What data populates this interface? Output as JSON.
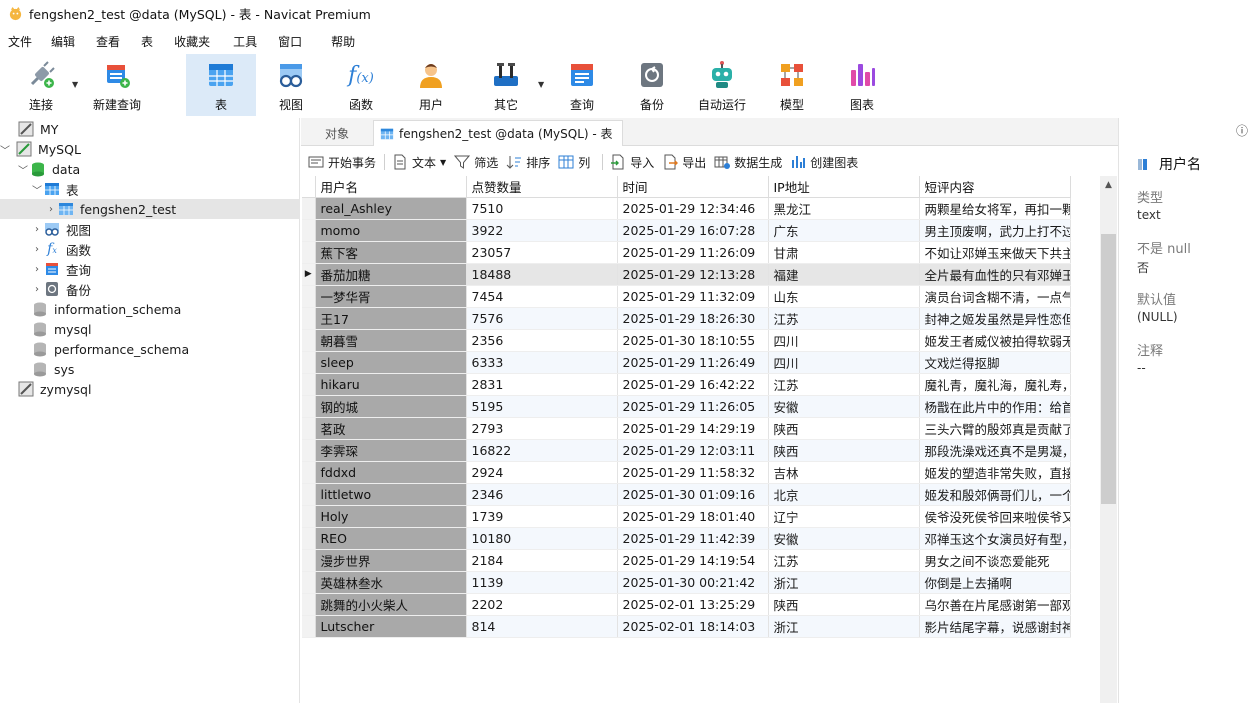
{
  "window": {
    "title": "fengshen2_test @data (MySQL) - 表 - Navicat Premium"
  },
  "menu": [
    "文件",
    "编辑",
    "查看",
    "表",
    "收藏夹",
    "工具",
    "窗口",
    "帮助"
  ],
  "toolbar": {
    "connect": "连接",
    "new_query": "新建查询",
    "table": "表",
    "view": "视图",
    "function": "函数",
    "user": "用户",
    "other": "其它",
    "query": "查询",
    "backup": "备份",
    "autorun": "自动运行",
    "model": "模型",
    "chart": "图表"
  },
  "tree": {
    "my": "MY",
    "mysql": "MySQL",
    "data": "data",
    "tables": "表",
    "fengshen": "fengshen2_test",
    "views": "视图",
    "functions": "函数",
    "queries": "查询",
    "backups": "备份",
    "info_schema": "information_schema",
    "mysql_db": "mysql",
    "perf_schema": "performance_schema",
    "sys": "sys",
    "zymysql": "zymysql"
  },
  "tabs": {
    "objects": "对象",
    "current": "fengshen2_test @data (MySQL) - 表"
  },
  "subtoolbar": {
    "begin_tx": "开始事务",
    "text": "文本",
    "filter": "筛选",
    "sort": "排序",
    "columns": "列",
    "import": "导入",
    "export": "导出",
    "datagen": "数据生成",
    "create_chart": "创建图表"
  },
  "grid": {
    "headers": [
      "用户名",
      "点赞数量",
      "时间",
      "IP地址",
      "短评内容"
    ],
    "rows": [
      [
        "real_Ashley",
        "7510",
        "2025-01-29 12:34:46",
        "黑龙江",
        "两颗星给女将军，再扣一颗"
      ],
      [
        "momo",
        "3922",
        "2025-01-29 16:07:28",
        "广东",
        "男主顶废啊，武力上打不过"
      ],
      [
        "蕉下客",
        "23057",
        "2025-01-29 11:26:09",
        "甘肃",
        "不如让邓婵玉来做天下共主"
      ],
      [
        "番茄加糖",
        "18488",
        "2025-01-29 12:13:28",
        "福建",
        "全片最有血性的只有邓婵玉"
      ],
      [
        "一梦华胥",
        "7454",
        "2025-01-29 11:32:09",
        "山东",
        "演员台词含糊不清，一点气"
      ],
      [
        "王17",
        "7576",
        "2025-01-29 18:26:30",
        "江苏",
        "封神之姬发虽然是异性恋但"
      ],
      [
        "朝暮雪",
        "2356",
        "2025-01-30 18:10:55",
        "四川",
        "姬发王者威仪被拍得软弱无"
      ],
      [
        "sleep",
        "6333",
        "2025-01-29 11:26:49",
        "四川",
        "文戏烂得抠脚"
      ],
      [
        "hikaru",
        "2831",
        "2025-01-29 16:42:22",
        "江苏",
        "魔礼青，魔礼海，魔礼寿，"
      ],
      [
        "钢的城",
        "5195",
        "2025-01-29 11:26:05",
        "安徽",
        "杨戬在此片中的作用：给首"
      ],
      [
        "茗政",
        "2793",
        "2025-01-29 14:29:19",
        "陕西",
        "三头六臂的殷郊真是贡献了"
      ],
      [
        "李霁琛",
        "16822",
        "2025-01-29 12:03:11",
        "陕西",
        "那段洗澡戏还真不是男凝，"
      ],
      [
        "fddxd",
        "2924",
        "2025-01-29 11:58:32",
        "吉林",
        "姬发的塑造非常失败，直接"
      ],
      [
        "littletwo",
        "2346",
        "2025-01-30 01:09:16",
        "北京",
        "姬发和殷郊俩哥们儿，一个"
      ],
      [
        "Holy",
        "1739",
        "2025-01-29 18:01:40",
        "辽宁",
        "侯爷没死侯爷回来啦侯爷又"
      ],
      [
        "REO",
        "10180",
        "2025-01-29 11:42:39",
        "安徽",
        "邓禅玉这个女演员好有型，"
      ],
      [
        "漫步世界",
        "2184",
        "2025-01-29 14:19:54",
        "江苏",
        "男女之间不谈恋爱能死"
      ],
      [
        "英雄林叁水",
        "1139",
        "2025-01-30 00:21:42",
        "浙江",
        "你倒是上去捅啊"
      ],
      [
        "跳舞的小火柴人",
        "2202",
        "2025-02-01 13:25:29",
        "陕西",
        "乌尔善在片尾感谢第一部观"
      ],
      [
        "Lutscher",
        "814",
        "2025-02-01 18:14:03",
        "浙江",
        "影片结尾字幕，说感谢封神"
      ]
    ]
  },
  "panel": {
    "field_name": "用户名",
    "type_label": "类型",
    "type_value": "text",
    "notnull_label": "不是 null",
    "notnull_value": "否",
    "default_label": "默认值",
    "default_value": "(NULL)",
    "comment_label": "注释",
    "comment_value": "--"
  },
  "colors": {
    "accent": "#1e88e5",
    "selected_tab": "#dceaf8",
    "name_column": "#a9a9a9"
  }
}
